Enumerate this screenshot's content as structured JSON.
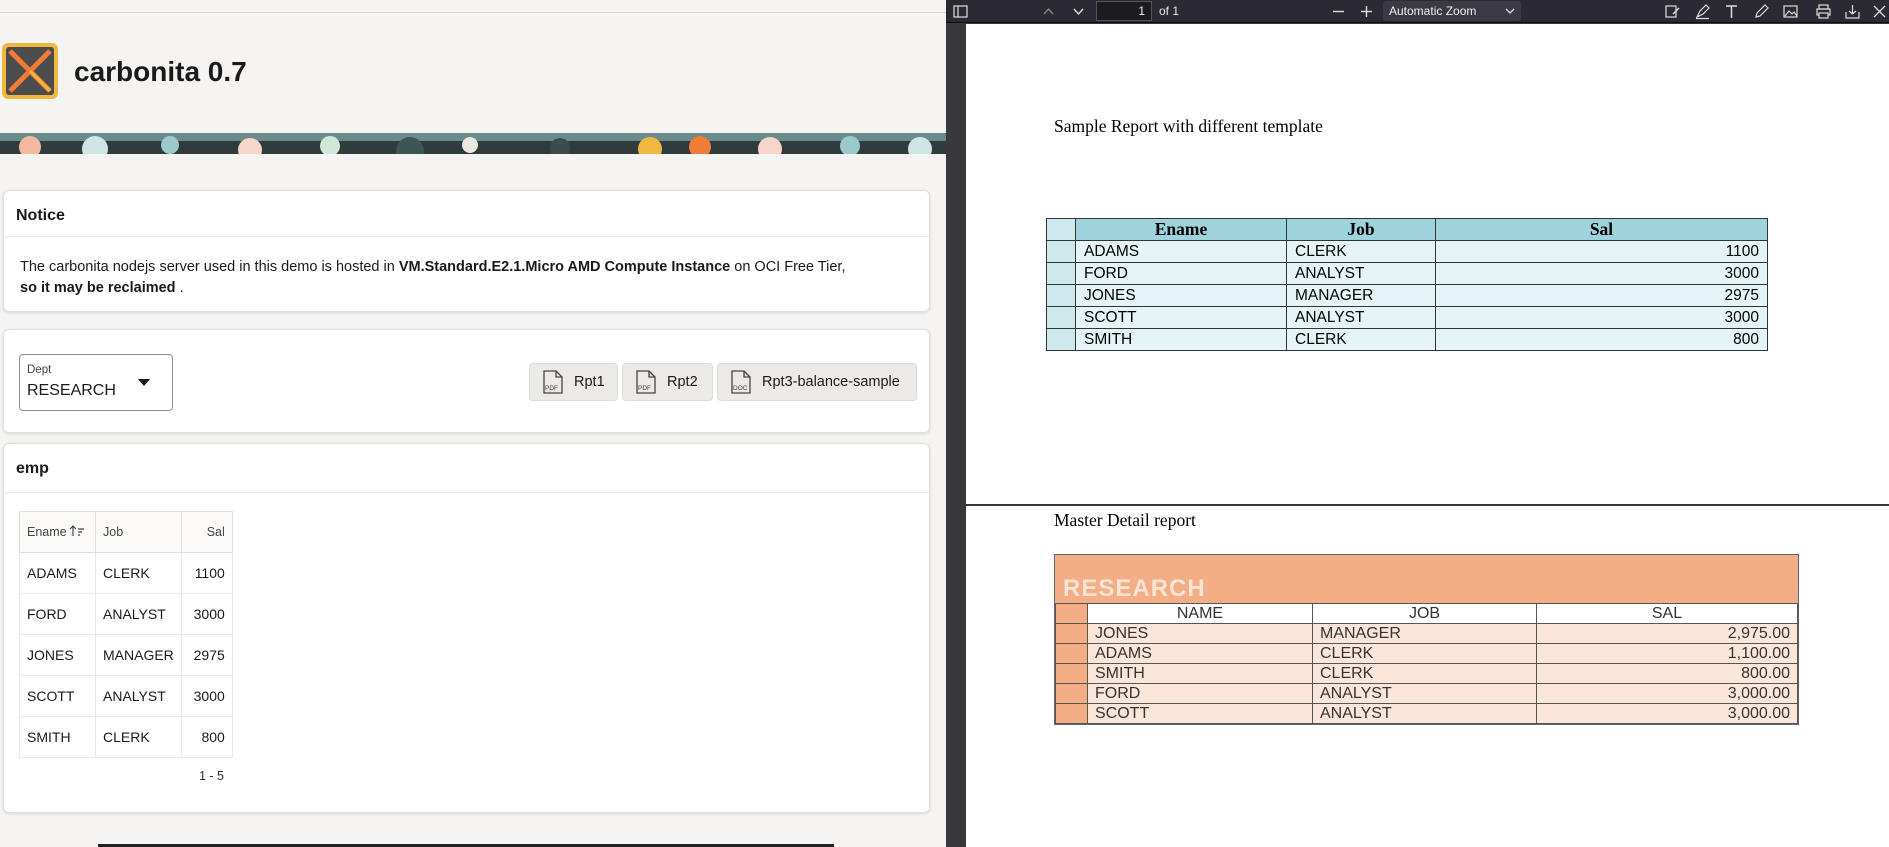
{
  "app": {
    "title": "carbonita 0.7",
    "colors": {
      "accent": "#f0b840",
      "logo_stroke": "#f27c35"
    }
  },
  "notice": {
    "title": "Notice",
    "text_1": "The carbonita nodejs server used in this demo is hosted in ",
    "text_bold_1": "VM.Standard.E2.1.Micro AMD Compute Instance",
    "text_2": " on OCI Free Tier,",
    "text_bold_2": "so it may be reclaimed",
    "text_3": " ."
  },
  "filters": {
    "dept": {
      "label": "Dept",
      "value": "RESEARCH"
    },
    "buttons": [
      {
        "label": "Rpt1",
        "icon": "pdf-file-icon"
      },
      {
        "label": "Rpt2",
        "icon": "pdf-file-icon"
      },
      {
        "label": "Rpt3-balance-sample",
        "icon": "doc-file-icon"
      }
    ]
  },
  "emp": {
    "title": "emp",
    "columns": [
      "Ename",
      "Job",
      "Sal"
    ],
    "rows": [
      [
        "ADAMS",
        "CLERK",
        "1100"
      ],
      [
        "FORD",
        "ANALYST",
        "3000"
      ],
      [
        "JONES",
        "MANAGER",
        "2975"
      ],
      [
        "SCOTT",
        "ANALYST",
        "3000"
      ],
      [
        "SMITH",
        "CLERK",
        "800"
      ]
    ],
    "pagination": "1 - 5"
  },
  "viewer": {
    "page_number": "1",
    "page_count": "of 1",
    "zoom": "Automatic Zoom"
  },
  "report1": {
    "heading": "Sample Report with different template",
    "columns": [
      "Ename",
      "Job",
      "Sal"
    ],
    "rows": [
      [
        "ADAMS",
        "CLERK",
        "1100"
      ],
      [
        "FORD",
        "ANALYST",
        "3000"
      ],
      [
        "JONES",
        "MANAGER",
        "2975"
      ],
      [
        "SCOTT",
        "ANALYST",
        "3000"
      ],
      [
        "SMITH",
        "CLERK",
        "800"
      ]
    ],
    "colors": {
      "header": "#9fd3db",
      "row": "#e5f4f6"
    }
  },
  "report2": {
    "heading": "Master Detail report",
    "group": "RESEARCH",
    "columns": [
      "NAME",
      "JOB",
      "SAL"
    ],
    "rows": [
      [
        "JONES",
        "MANAGER",
        "2,975.00"
      ],
      [
        "ADAMS",
        "CLERK",
        "1,100.00"
      ],
      [
        "SMITH",
        "CLERK",
        "800.00"
      ],
      [
        "FORD",
        "ANALYST",
        "3,000.00"
      ],
      [
        "SCOTT",
        "ANALYST",
        "3,000.00"
      ]
    ],
    "colors": {
      "band": "#f4ae86",
      "row": "#fce6da"
    }
  }
}
